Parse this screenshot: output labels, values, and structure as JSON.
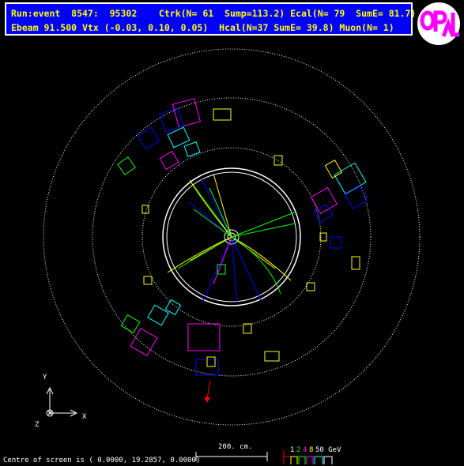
{
  "header": {
    "line1": "Run:event  8547:  95302    Ctrk(N= 61  Sump=113.2) Ecal(N= 79  SumE= 81.7)",
    "line2": "Ebeam 91.500 Vtx (-0.03, 0.10, 0.05)  Hcal(N=37 SumE= 39.8) Muon(N= 1)"
  },
  "logo": {
    "text": "OPAL"
  },
  "axes": {
    "y": "Y",
    "x": "X",
    "z": "Z"
  },
  "scale": {
    "label": "200. cm."
  },
  "energy": {
    "ticks": [
      "1",
      "2",
      "4",
      "8",
      "50 GeV"
    ],
    "colors": [
      "#ffffff",
      "#00ff00",
      "#ff00ff",
      "#ffff00",
      "#ffffff"
    ]
  },
  "footer": {
    "centre": "Centre of screen is (   0.0000,  19.2857,   0.0000)"
  },
  "colors": {
    "header_bg": "#0000ff",
    "text": "#ffff00",
    "inner_detector": "#ffffff",
    "tracks_a": "#00ff00",
    "tracks_b": "#ffff00",
    "tracks_c": "#0000ff",
    "ecal": "#ff00ff",
    "hcal": "#0000ff",
    "muon": "#ff0000",
    "cyan": "#00ffff"
  }
}
